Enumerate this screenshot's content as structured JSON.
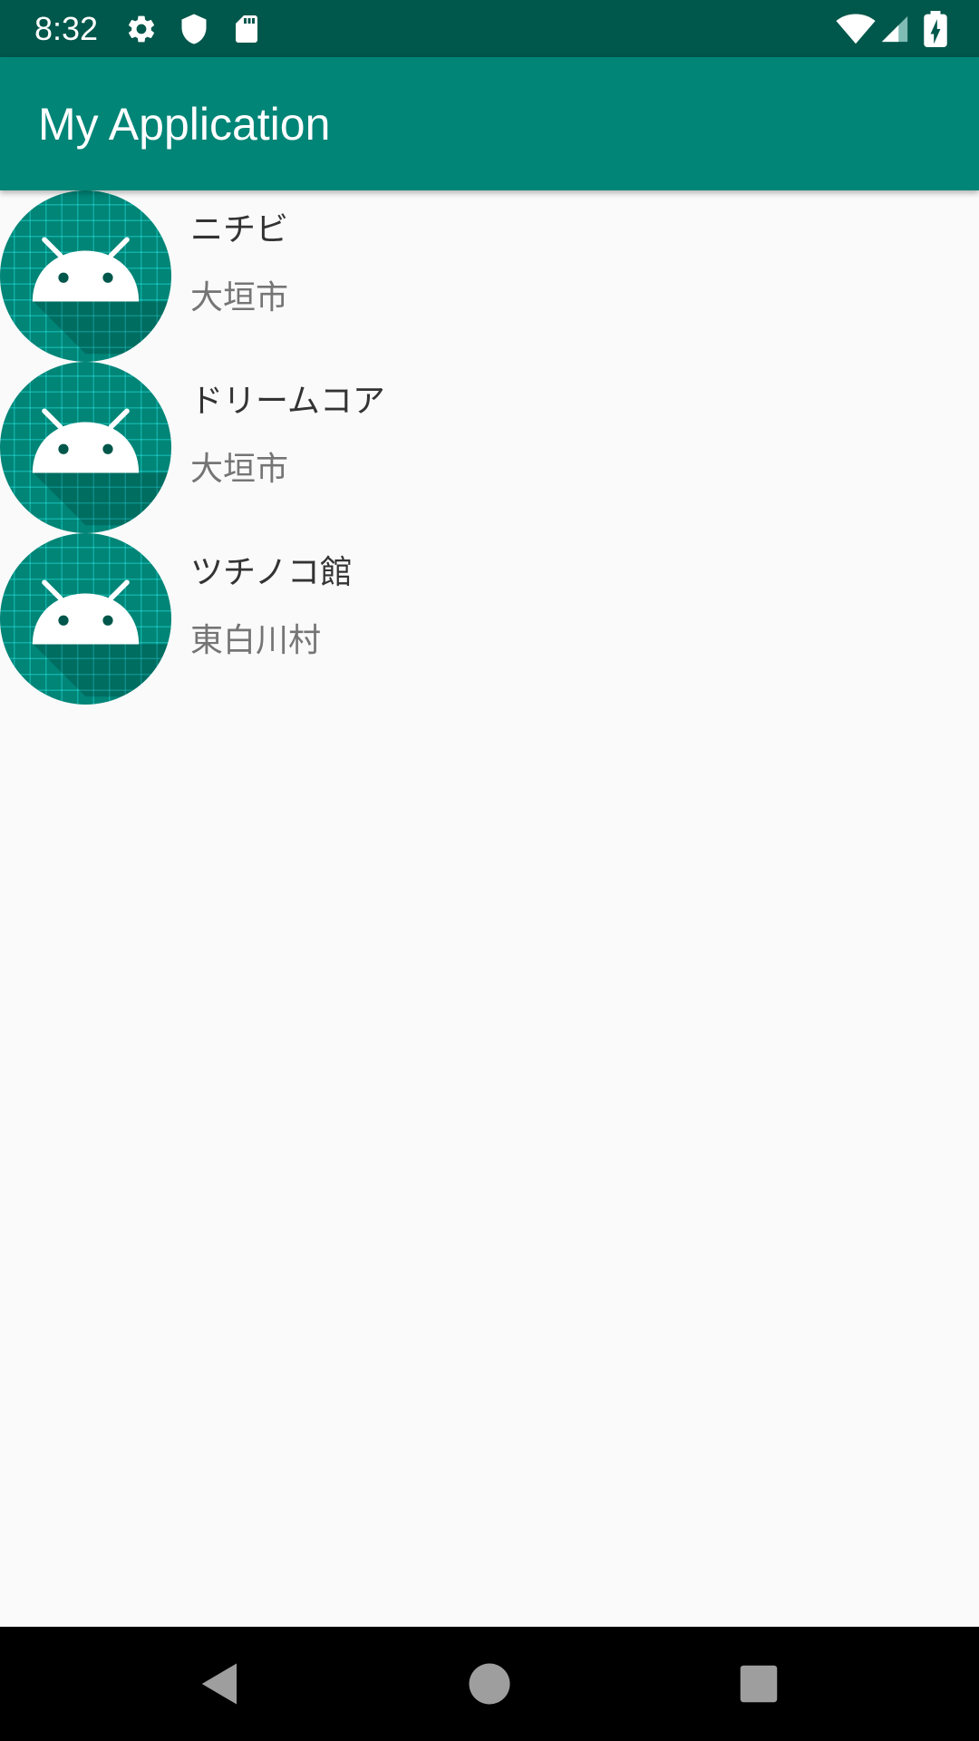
{
  "status_bar": {
    "time": "8:32",
    "left_icons": [
      "settings-gear-icon",
      "shield-icon",
      "sd-card-icon"
    ],
    "right_icons": [
      "wifi-icon",
      "cell-signal-icon",
      "battery-charging-icon"
    ]
  },
  "app_bar": {
    "title": "My Application",
    "color": "#008577"
  },
  "list": {
    "items": [
      {
        "title": "ニチビ",
        "subtitle": "大垣市",
        "icon": "android-avatar-icon"
      },
      {
        "title": "ドリームコア",
        "subtitle": "大垣市",
        "icon": "android-avatar-icon"
      },
      {
        "title": "ツチノコ館",
        "subtitle": "東白川村",
        "icon": "android-avatar-icon"
      }
    ]
  },
  "nav_bar": {
    "buttons": [
      "back-icon",
      "home-icon",
      "recents-icon"
    ]
  },
  "colors": {
    "status_bar": "#00574b",
    "app_bar": "#008577",
    "background": "#fafafa",
    "avatar_bg": "#008577"
  }
}
